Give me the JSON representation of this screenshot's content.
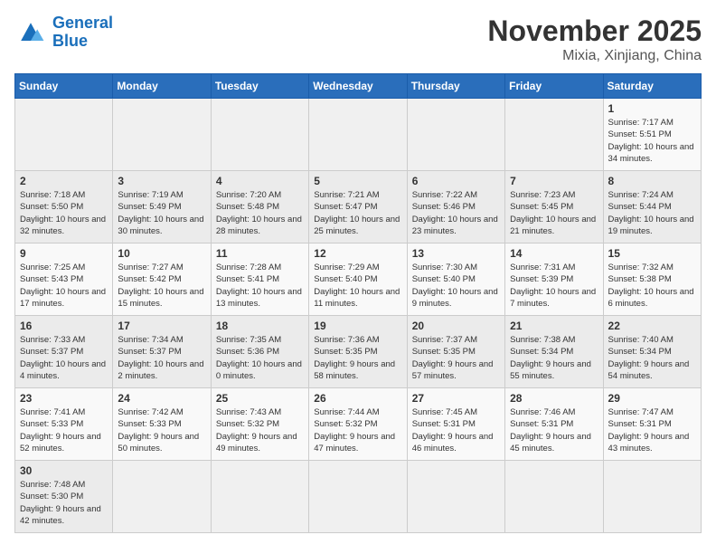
{
  "logo": {
    "general": "General",
    "blue": "Blue"
  },
  "header": {
    "month": "November 2025",
    "location": "Mixia, Xinjiang, China"
  },
  "weekdays": [
    "Sunday",
    "Monday",
    "Tuesday",
    "Wednesday",
    "Thursday",
    "Friday",
    "Saturday"
  ],
  "days": [
    {
      "date": "",
      "info": ""
    },
    {
      "date": "",
      "info": ""
    },
    {
      "date": "",
      "info": ""
    },
    {
      "date": "",
      "info": ""
    },
    {
      "date": "",
      "info": ""
    },
    {
      "date": "",
      "info": ""
    },
    {
      "date": "1",
      "sunrise": "7:17 AM",
      "sunset": "5:51 PM",
      "daylight": "10 hours and 34 minutes."
    },
    {
      "date": "2",
      "sunrise": "7:18 AM",
      "sunset": "5:50 PM",
      "daylight": "10 hours and 32 minutes."
    },
    {
      "date": "3",
      "sunrise": "7:19 AM",
      "sunset": "5:49 PM",
      "daylight": "10 hours and 30 minutes."
    },
    {
      "date": "4",
      "sunrise": "7:20 AM",
      "sunset": "5:48 PM",
      "daylight": "10 hours and 28 minutes."
    },
    {
      "date": "5",
      "sunrise": "7:21 AM",
      "sunset": "5:47 PM",
      "daylight": "10 hours and 25 minutes."
    },
    {
      "date": "6",
      "sunrise": "7:22 AM",
      "sunset": "5:46 PM",
      "daylight": "10 hours and 23 minutes."
    },
    {
      "date": "7",
      "sunrise": "7:23 AM",
      "sunset": "5:45 PM",
      "daylight": "10 hours and 21 minutes."
    },
    {
      "date": "8",
      "sunrise": "7:24 AM",
      "sunset": "5:44 PM",
      "daylight": "10 hours and 19 minutes."
    },
    {
      "date": "9",
      "sunrise": "7:25 AM",
      "sunset": "5:43 PM",
      "daylight": "10 hours and 17 minutes."
    },
    {
      "date": "10",
      "sunrise": "7:27 AM",
      "sunset": "5:42 PM",
      "daylight": "10 hours and 15 minutes."
    },
    {
      "date": "11",
      "sunrise": "7:28 AM",
      "sunset": "5:41 PM",
      "daylight": "10 hours and 13 minutes."
    },
    {
      "date": "12",
      "sunrise": "7:29 AM",
      "sunset": "5:40 PM",
      "daylight": "10 hours and 11 minutes."
    },
    {
      "date": "13",
      "sunrise": "7:30 AM",
      "sunset": "5:40 PM",
      "daylight": "10 hours and 9 minutes."
    },
    {
      "date": "14",
      "sunrise": "7:31 AM",
      "sunset": "5:39 PM",
      "daylight": "10 hours and 7 minutes."
    },
    {
      "date": "15",
      "sunrise": "7:32 AM",
      "sunset": "5:38 PM",
      "daylight": "10 hours and 6 minutes."
    },
    {
      "date": "16",
      "sunrise": "7:33 AM",
      "sunset": "5:37 PM",
      "daylight": "10 hours and 4 minutes."
    },
    {
      "date": "17",
      "sunrise": "7:34 AM",
      "sunset": "5:37 PM",
      "daylight": "10 hours and 2 minutes."
    },
    {
      "date": "18",
      "sunrise": "7:35 AM",
      "sunset": "5:36 PM",
      "daylight": "10 hours and 0 minutes."
    },
    {
      "date": "19",
      "sunrise": "7:36 AM",
      "sunset": "5:35 PM",
      "daylight": "9 hours and 58 minutes."
    },
    {
      "date": "20",
      "sunrise": "7:37 AM",
      "sunset": "5:35 PM",
      "daylight": "9 hours and 57 minutes."
    },
    {
      "date": "21",
      "sunrise": "7:38 AM",
      "sunset": "5:34 PM",
      "daylight": "9 hours and 55 minutes."
    },
    {
      "date": "22",
      "sunrise": "7:40 AM",
      "sunset": "5:34 PM",
      "daylight": "9 hours and 54 minutes."
    },
    {
      "date": "23",
      "sunrise": "7:41 AM",
      "sunset": "5:33 PM",
      "daylight": "9 hours and 52 minutes."
    },
    {
      "date": "24",
      "sunrise": "7:42 AM",
      "sunset": "5:33 PM",
      "daylight": "9 hours and 50 minutes."
    },
    {
      "date": "25",
      "sunrise": "7:43 AM",
      "sunset": "5:32 PM",
      "daylight": "9 hours and 49 minutes."
    },
    {
      "date": "26",
      "sunrise": "7:44 AM",
      "sunset": "5:32 PM",
      "daylight": "9 hours and 47 minutes."
    },
    {
      "date": "27",
      "sunrise": "7:45 AM",
      "sunset": "5:31 PM",
      "daylight": "9 hours and 46 minutes."
    },
    {
      "date": "28",
      "sunrise": "7:46 AM",
      "sunset": "5:31 PM",
      "daylight": "9 hours and 45 minutes."
    },
    {
      "date": "29",
      "sunrise": "7:47 AM",
      "sunset": "5:31 PM",
      "daylight": "9 hours and 43 minutes."
    },
    {
      "date": "30",
      "sunrise": "7:48 AM",
      "sunset": "5:30 PM",
      "daylight": "9 hours and 42 minutes."
    }
  ]
}
